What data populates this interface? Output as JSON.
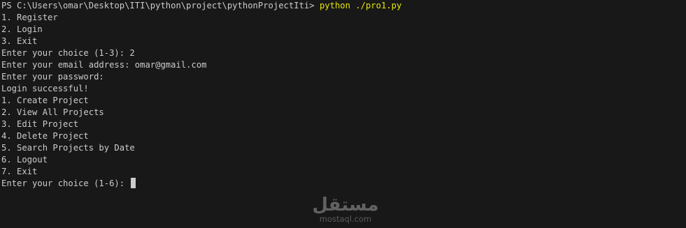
{
  "terminal": {
    "prompt": {
      "path": "PS C:\\Users\\omar\\Desktop\\ITI\\python\\project\\pythonProjectIti> ",
      "command": "python ./pro1.py"
    },
    "lines": [
      "1. Register",
      "2. Login",
      "3. Exit",
      "Enter your choice (1-3): 2",
      "Enter your email address: omar@gmail.com",
      "Enter your password:",
      "Login successful!",
      "1. Create Project",
      "2. View All Projects",
      "3. Edit Project",
      "4. Delete Project",
      "5. Search Projects by Date",
      "6. Logout",
      "7. Exit"
    ],
    "current_prompt": "Enter your choice (1-6): "
  },
  "watermark": {
    "logo_text": "مستقل",
    "url": "mostaql.com"
  },
  "colors": {
    "background": "#181818",
    "text": "#cccccc",
    "command": "#e5e510"
  }
}
